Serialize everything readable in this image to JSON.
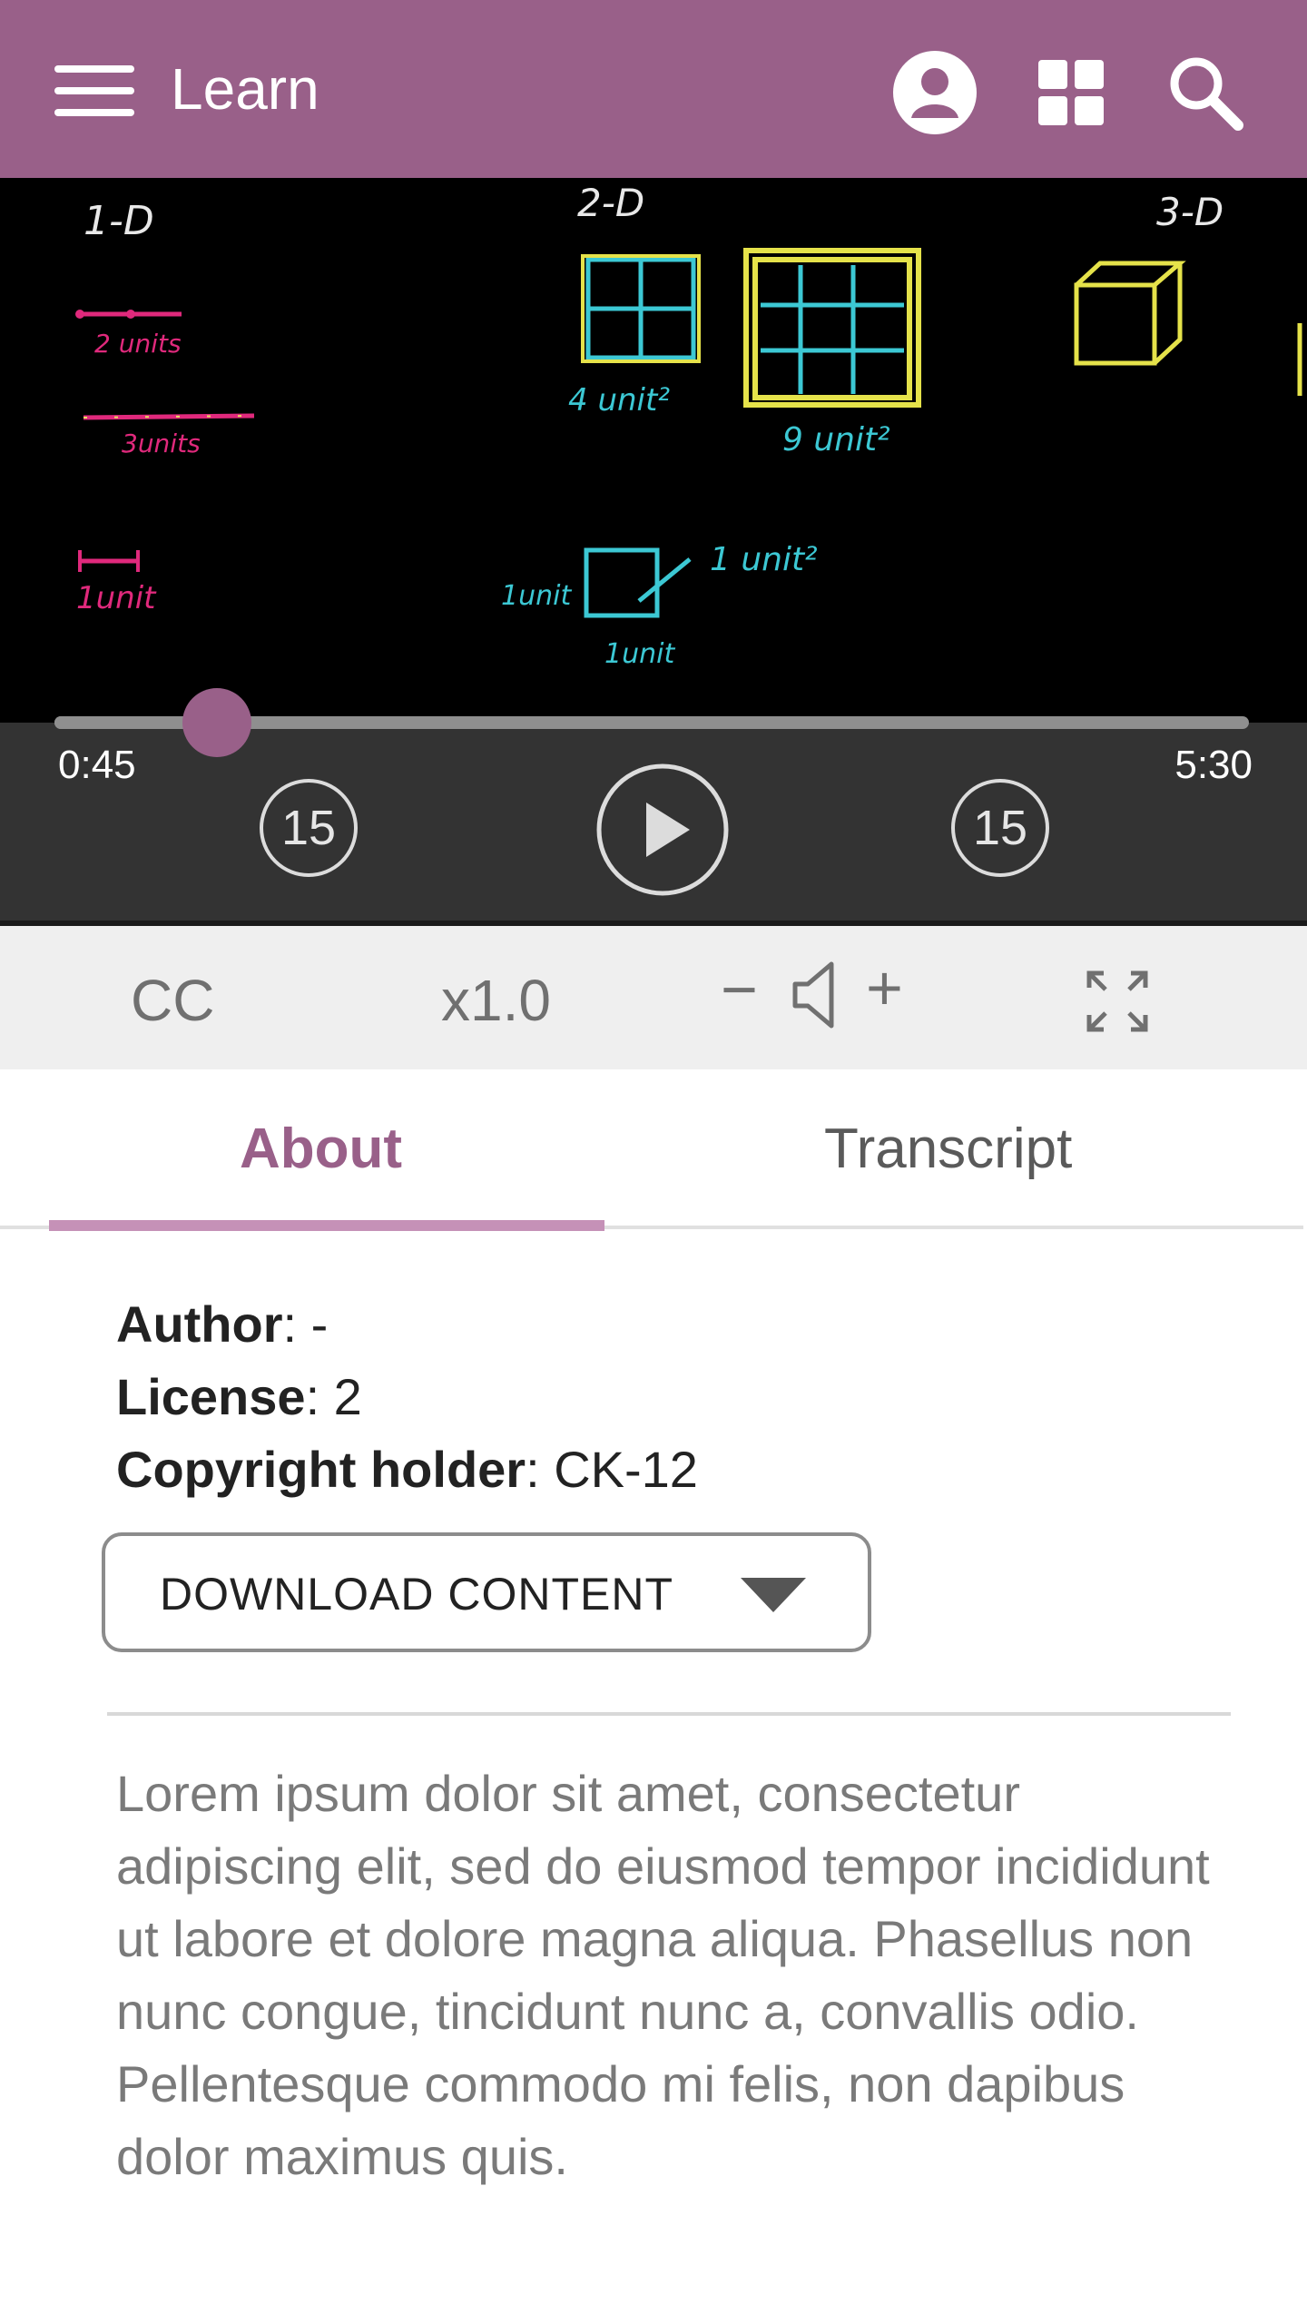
{
  "header": {
    "title": "Learn",
    "background": "#996089",
    "icons": [
      "menu-icon",
      "user-icon",
      "apps-grid-icon",
      "search-icon"
    ]
  },
  "player": {
    "current_time": "0:45",
    "total_time": "5:30",
    "progress_fraction": 0.136,
    "skip_back_seconds": "15",
    "skip_forward_seconds": "15",
    "accent": "#996089"
  },
  "video": {
    "labels": {
      "one_d": "1-D",
      "two_d": "2-D",
      "three_d": "3-D",
      "two_units": "2 units",
      "three_units": "3units",
      "one_unit_line": "1unit",
      "four_unit_sq": "4 unit²",
      "nine_unit_sq": "9 unit²",
      "one_unit_sq": "1 unit²",
      "one_unit_side": "1unit",
      "one_unit_bottom": "1unit"
    }
  },
  "options": {
    "cc": "CC",
    "speed": "x1.0",
    "volume_minus": "−",
    "volume_plus": "+"
  },
  "tabs": {
    "about": "About",
    "transcript": "Transcript",
    "active": "about"
  },
  "about": {
    "author_label": "Author",
    "author_value": ": -",
    "license_label": "License",
    "license_value": ": 2",
    "holder_label": "Copyright holder",
    "holder_value": ": CK-12",
    "download_label": "DOWNLOAD CONTENT",
    "description": "Lorem ipsum dolor sit amet, consectetur adipiscing elit, sed do eiusmod tempor incididunt ut labore et dolore magna aliqua. Phasellus non nunc congue, tincidunt nunc a, convallis odio. Pellentesque commodo mi felis, non dapibus dolor maximus quis."
  }
}
